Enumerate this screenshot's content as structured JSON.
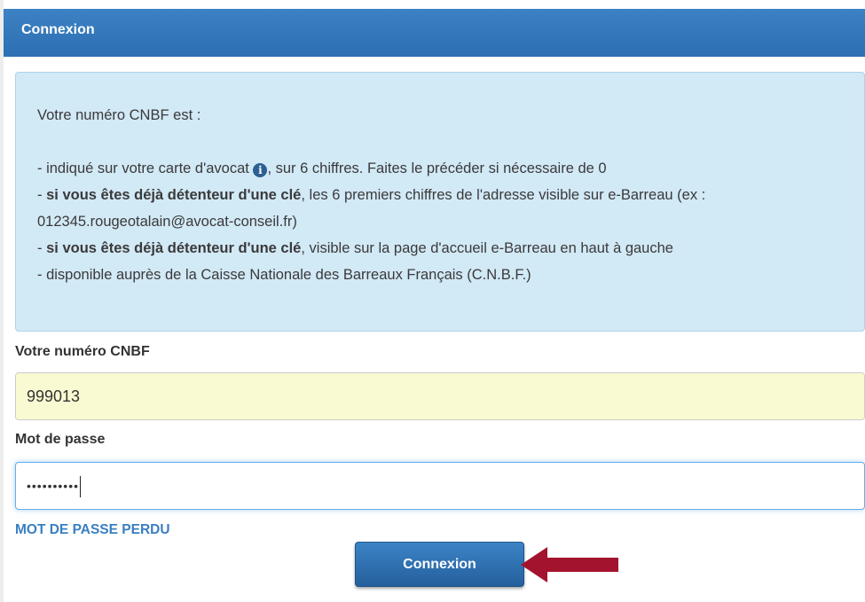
{
  "header": {
    "title": "Connexion"
  },
  "info": {
    "intro": "Votre numéro CNBF est :",
    "line1_text": "- indiqué sur votre carte d'avocat",
    "line1_icon": "info-circle-icon",
    "line1_rest": ", sur 6 chiffres. Faites le précéder si nécessaire de 0",
    "line2_prefix": "- ",
    "line2_bold": "si vous êtes déjà détenteur d'une clé",
    "line2_rest": ", les 6 premiers chiffres de l'adresse visible sur e-Barreau (ex : 012345.rougeotalain@avocat-conseil.fr)",
    "line3_prefix": "- ",
    "line3_bold": "si vous êtes déjà détenteur d'une clé",
    "line3_rest": ", visible sur la page d'accueil e-Barreau en haut à gauche",
    "line4": "- disponible auprès de la Caisse Nationale des Barreaux Français (C.N.B.F.)"
  },
  "form": {
    "cnbf_label": "Votre numéro CNBF",
    "cnbf_value": "999013",
    "password_label": "Mot de passe",
    "password_value": "••••••••••",
    "forgot_link": "MOT DE PASSE PERDU",
    "submit_label": "Connexion"
  },
  "colors": {
    "header_bg": "#2c6fb2",
    "info_bg": "#d2e9f6",
    "autofill_bg": "#fafad2",
    "link": "#3a7fc1",
    "arrow": "#a3132d"
  }
}
